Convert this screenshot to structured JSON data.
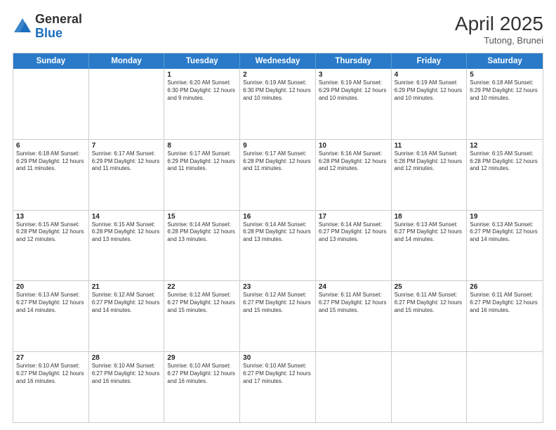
{
  "header": {
    "logo_general": "General",
    "logo_blue": "Blue",
    "month_title": "April 2025",
    "location": "Tutong, Brunei"
  },
  "weekdays": [
    "Sunday",
    "Monday",
    "Tuesday",
    "Wednesday",
    "Thursday",
    "Friday",
    "Saturday"
  ],
  "rows": [
    [
      {
        "day": "",
        "info": ""
      },
      {
        "day": "",
        "info": ""
      },
      {
        "day": "1",
        "info": "Sunrise: 6:20 AM\nSunset: 6:30 PM\nDaylight: 12 hours and 9 minutes."
      },
      {
        "day": "2",
        "info": "Sunrise: 6:19 AM\nSunset: 6:30 PM\nDaylight: 12 hours and 10 minutes."
      },
      {
        "day": "3",
        "info": "Sunrise: 6:19 AM\nSunset: 6:29 PM\nDaylight: 12 hours and 10 minutes."
      },
      {
        "day": "4",
        "info": "Sunrise: 6:19 AM\nSunset: 6:29 PM\nDaylight: 12 hours and 10 minutes."
      },
      {
        "day": "5",
        "info": "Sunrise: 6:18 AM\nSunset: 6:29 PM\nDaylight: 12 hours and 10 minutes."
      }
    ],
    [
      {
        "day": "6",
        "info": "Sunrise: 6:18 AM\nSunset: 6:29 PM\nDaylight: 12 hours and 11 minutes."
      },
      {
        "day": "7",
        "info": "Sunrise: 6:17 AM\nSunset: 6:29 PM\nDaylight: 12 hours and 11 minutes."
      },
      {
        "day": "8",
        "info": "Sunrise: 6:17 AM\nSunset: 6:29 PM\nDaylight: 12 hours and 11 minutes."
      },
      {
        "day": "9",
        "info": "Sunrise: 6:17 AM\nSunset: 6:28 PM\nDaylight: 12 hours and 11 minutes."
      },
      {
        "day": "10",
        "info": "Sunrise: 6:16 AM\nSunset: 6:28 PM\nDaylight: 12 hours and 12 minutes."
      },
      {
        "day": "11",
        "info": "Sunrise: 6:16 AM\nSunset: 6:28 PM\nDaylight: 12 hours and 12 minutes."
      },
      {
        "day": "12",
        "info": "Sunrise: 6:15 AM\nSunset: 6:28 PM\nDaylight: 12 hours and 12 minutes."
      }
    ],
    [
      {
        "day": "13",
        "info": "Sunrise: 6:15 AM\nSunset: 6:28 PM\nDaylight: 12 hours and 12 minutes."
      },
      {
        "day": "14",
        "info": "Sunrise: 6:15 AM\nSunset: 6:28 PM\nDaylight: 12 hours and 13 minutes."
      },
      {
        "day": "15",
        "info": "Sunrise: 6:14 AM\nSunset: 6:28 PM\nDaylight: 12 hours and 13 minutes."
      },
      {
        "day": "16",
        "info": "Sunrise: 6:14 AM\nSunset: 6:28 PM\nDaylight: 12 hours and 13 minutes."
      },
      {
        "day": "17",
        "info": "Sunrise: 6:14 AM\nSunset: 6:27 PM\nDaylight: 12 hours and 13 minutes."
      },
      {
        "day": "18",
        "info": "Sunrise: 6:13 AM\nSunset: 6:27 PM\nDaylight: 12 hours and 14 minutes."
      },
      {
        "day": "19",
        "info": "Sunrise: 6:13 AM\nSunset: 6:27 PM\nDaylight: 12 hours and 14 minutes."
      }
    ],
    [
      {
        "day": "20",
        "info": "Sunrise: 6:13 AM\nSunset: 6:27 PM\nDaylight: 12 hours and 14 minutes."
      },
      {
        "day": "21",
        "info": "Sunrise: 6:12 AM\nSunset: 6:27 PM\nDaylight: 12 hours and 14 minutes."
      },
      {
        "day": "22",
        "info": "Sunrise: 6:12 AM\nSunset: 6:27 PM\nDaylight: 12 hours and 15 minutes."
      },
      {
        "day": "23",
        "info": "Sunrise: 6:12 AM\nSunset: 6:27 PM\nDaylight: 12 hours and 15 minutes."
      },
      {
        "day": "24",
        "info": "Sunrise: 6:11 AM\nSunset: 6:27 PM\nDaylight: 12 hours and 15 minutes."
      },
      {
        "day": "25",
        "info": "Sunrise: 6:11 AM\nSunset: 6:27 PM\nDaylight: 12 hours and 15 minutes."
      },
      {
        "day": "26",
        "info": "Sunrise: 6:11 AM\nSunset: 6:27 PM\nDaylight: 12 hours and 16 minutes."
      }
    ],
    [
      {
        "day": "27",
        "info": "Sunrise: 6:10 AM\nSunset: 6:27 PM\nDaylight: 12 hours and 16 minutes."
      },
      {
        "day": "28",
        "info": "Sunrise: 6:10 AM\nSunset: 6:27 PM\nDaylight: 12 hours and 16 minutes."
      },
      {
        "day": "29",
        "info": "Sunrise: 6:10 AM\nSunset: 6:27 PM\nDaylight: 12 hours and 16 minutes."
      },
      {
        "day": "30",
        "info": "Sunrise: 6:10 AM\nSunset: 6:27 PM\nDaylight: 12 hours and 17 minutes."
      },
      {
        "day": "",
        "info": ""
      },
      {
        "day": "",
        "info": ""
      },
      {
        "day": "",
        "info": ""
      }
    ]
  ]
}
